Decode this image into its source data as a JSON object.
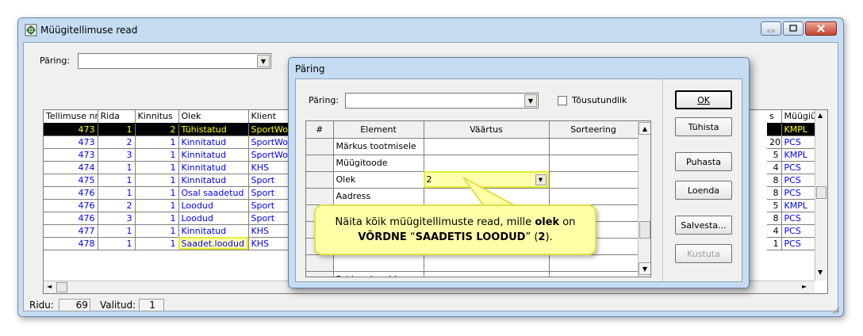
{
  "window": {
    "title": "Müügitellimuse read",
    "query_label": "Päring:",
    "query_value": ""
  },
  "main_grid": {
    "headers": [
      "Tellimuse nr.",
      "Rida",
      "Kinnitus",
      "Olek",
      "Klient"
    ],
    "rows": [
      [
        "473",
        "1",
        "2",
        "Tühistatud",
        "SportWor"
      ],
      [
        "473",
        "2",
        "1",
        "Kinnitatud",
        "SportWor"
      ],
      [
        "473",
        "3",
        "1",
        "Kinnitatud",
        "SportWor"
      ],
      [
        "474",
        "1",
        "1",
        "Kinnitatud",
        "KHS"
      ],
      [
        "475",
        "1",
        "1",
        "Kinnitatud",
        "Sport"
      ],
      [
        "476",
        "1",
        "1",
        "Osal saadetud",
        "Sport"
      ],
      [
        "476",
        "2",
        "1",
        "Loodud",
        "Sport"
      ],
      [
        "476",
        "3",
        "1",
        "Loodud",
        "Sport"
      ],
      [
        "477",
        "1",
        "1",
        "Kinnitatud",
        "KHS"
      ],
      [
        "478",
        "1",
        "1",
        "Saadet.loodud",
        "KHS"
      ]
    ]
  },
  "right_grid": {
    "headers": [
      "s",
      "Müügiüh"
    ],
    "rows": [
      [
        "",
        "KMPL"
      ],
      [
        "20",
        "PCS"
      ],
      [
        "5",
        "KMPL"
      ],
      [
        "4",
        "PCS"
      ],
      [
        "8",
        "PCS"
      ],
      [
        "8",
        "PCS"
      ],
      [
        "5",
        "KMPL"
      ],
      [
        "8",
        "PCS"
      ],
      [
        "4",
        "PCS"
      ],
      [
        "1",
        "PCS"
      ]
    ]
  },
  "status": {
    "rows_label": "Ridu:",
    "rows_value": "69",
    "selected_label": "Valitud:",
    "selected_value": "1"
  },
  "dialog": {
    "title": "Päring",
    "query_label": "Päring:",
    "query_value": "",
    "ascending_label": "Tõusutundlik",
    "columns": [
      "#",
      "Element",
      "Väärtus",
      "Sorteering"
    ],
    "rows": [
      {
        "element": "Märkus tootmisele",
        "value": "",
        "sort": ""
      },
      {
        "element": "Müügitoode",
        "value": "",
        "sort": ""
      },
      {
        "element": "Olek",
        "value": "2",
        "sort": ""
      },
      {
        "element": "Aadress",
        "value": "",
        "sort": ""
      },
      {
        "element": "",
        "value": "",
        "sort": ""
      },
      {
        "element": "",
        "value": "",
        "sort": ""
      },
      {
        "element": "",
        "value": "",
        "sort": ""
      },
      {
        "element": "",
        "value": "",
        "sort": ""
      },
      {
        "element": "Pakkumise rida",
        "value": "",
        "sort": ""
      }
    ],
    "buttons": {
      "ok": "OK",
      "cancel": "Tühista",
      "clear": "Puhasta",
      "list": "Loenda",
      "save": "Salvesta...",
      "delete": "Kustuta"
    }
  },
  "callout": {
    "line1_prefix": "Näita kõik müügitellimuste read, mille ",
    "line1_bold": "olek",
    "line1_suffix": " on",
    "line2_bold1": "VÕRDNE",
    "line2_mid": " “",
    "line2_bold2": "SAADETIS LOODUD",
    "line2_suffix1": "” (",
    "line2_bold3": "2",
    "line2_suffix2": ")."
  },
  "colors": {
    "highlight": "#ffffa8",
    "selected_row_bg": "#000000",
    "selected_row_text": "#ffff00",
    "cell_text": "#0000ff"
  }
}
